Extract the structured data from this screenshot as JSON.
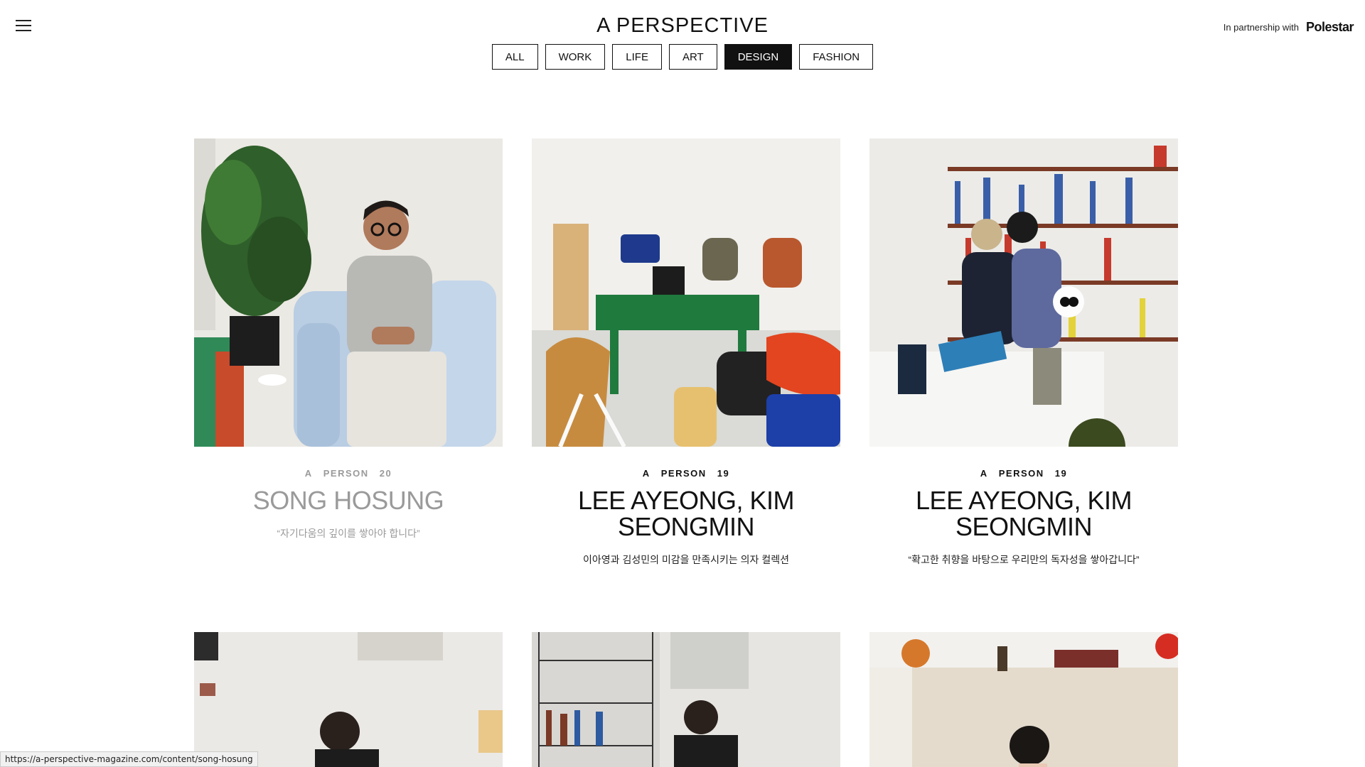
{
  "header": {
    "logo": "A  PERSPECTIVE",
    "partner_text": "In partnership with",
    "partner_brand": "Polestar"
  },
  "filters": [
    {
      "label": "ALL",
      "active": false
    },
    {
      "label": "WORK",
      "active": false
    },
    {
      "label": "LIFE",
      "active": false
    },
    {
      "label": "ART",
      "active": false
    },
    {
      "label": "DESIGN",
      "active": true
    },
    {
      "label": "FASHION",
      "active": false
    }
  ],
  "cards": [
    {
      "meta_a": "A",
      "meta_person": "PERSON",
      "meta_num": "20",
      "name": "SONG HOSUNG",
      "quote": "“자기다움의 깊이를 쌓아야 합니다”"
    },
    {
      "meta_a": "A",
      "meta_person": "PERSON",
      "meta_num": "19",
      "name": "LEE AYEONG, KIM SEONGMIN",
      "quote": "이아영과 김성민의 미감을 만족시키는 의자 컬렉션"
    },
    {
      "meta_a": "A",
      "meta_person": "PERSON",
      "meta_num": "19",
      "name": "LEE AYEONG, KIM SEONGMIN",
      "quote": "“확고한 취향을 바탕으로 우리만의 독자성을 쌓아갑니다”"
    }
  ],
  "statusbar": {
    "url": "https://a-perspective-magazine.com/content/song-hosung"
  },
  "colors": {
    "accent": "#111111",
    "background": "#ffffff",
    "dimmed": "#9a9a9a"
  }
}
